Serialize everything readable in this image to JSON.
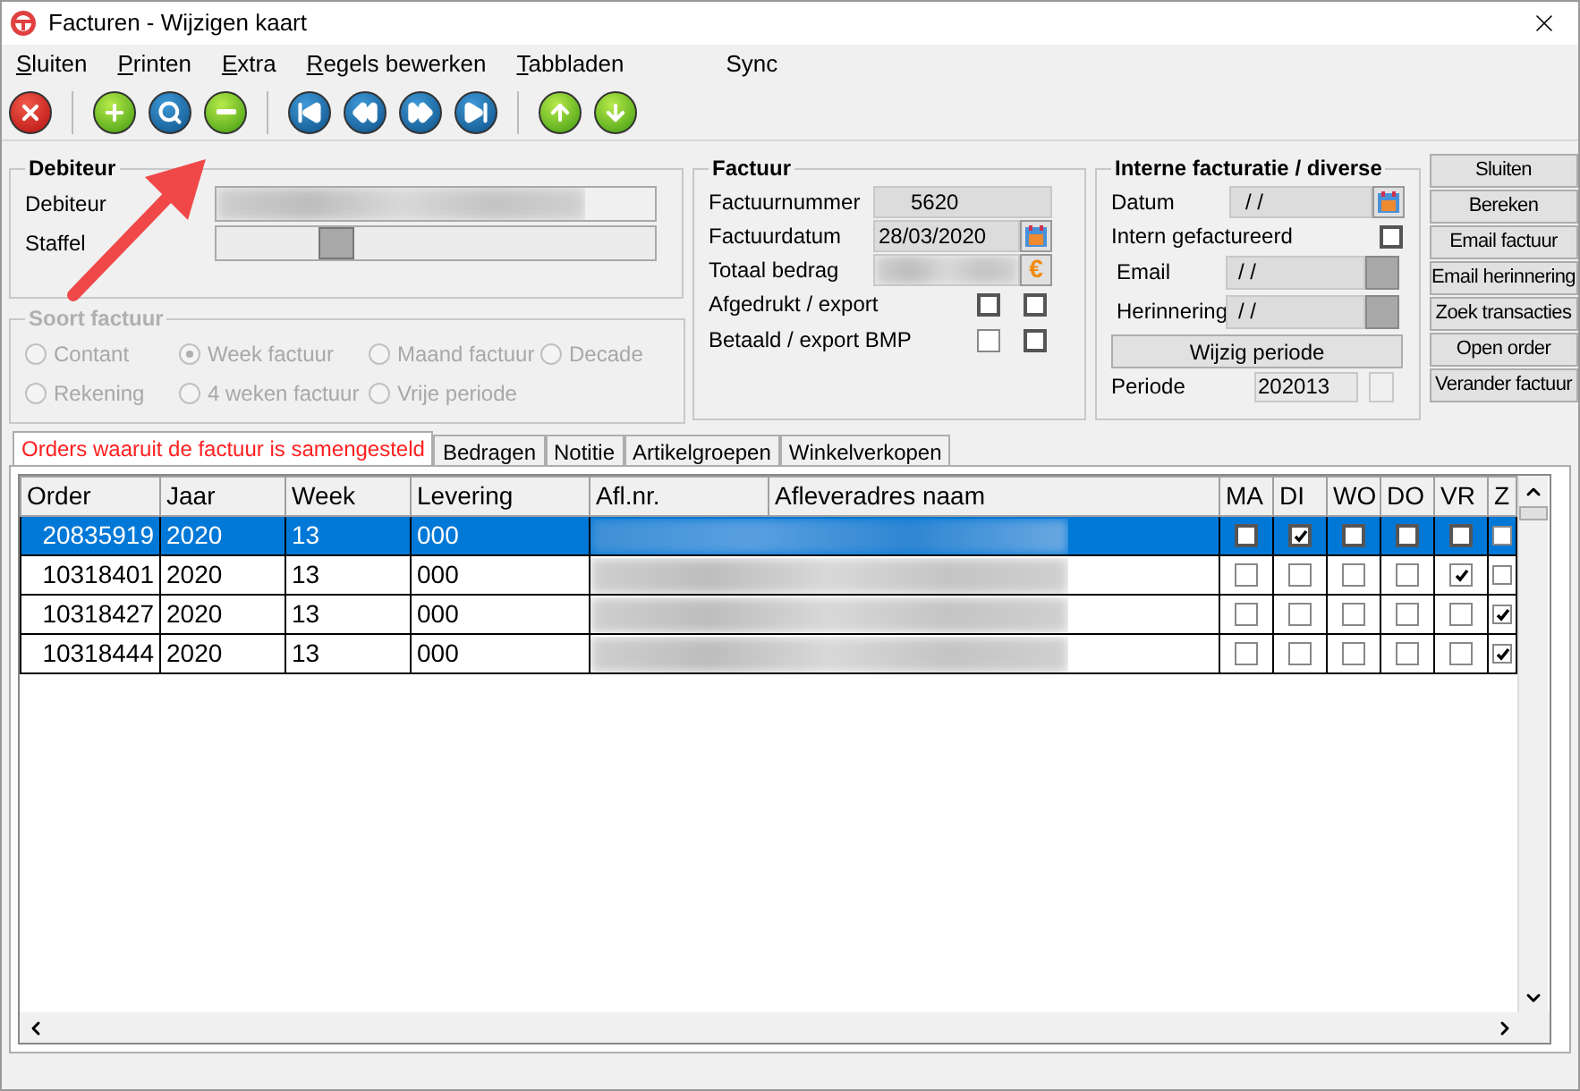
{
  "window": {
    "title": "Facturen - Wijzigen kaart"
  },
  "menu": [
    {
      "label": "Sluiten",
      "underlined": true
    },
    {
      "label": "Printen",
      "underlined": true
    },
    {
      "label": "Extra",
      "underlined": true
    },
    {
      "label": "Regels bewerken",
      "underlined": true
    },
    {
      "label": "Tabbladen",
      "underlined": true
    },
    {
      "label": "Sync",
      "underlined": false
    }
  ],
  "debiteur": {
    "title": "Debiteur",
    "debiteur_label": "Debiteur",
    "staffel_label": "Staffel",
    "staffel": {
      "level": 0.24
    }
  },
  "soort_factuur": {
    "title": "Soort factuur",
    "disabled": true,
    "options": [
      {
        "label": "Contant",
        "selected": false
      },
      {
        "label": "Week factuur",
        "selected": true
      },
      {
        "label": "Maand factuur",
        "selected": false
      },
      {
        "label": "Decade",
        "selected": false
      },
      {
        "label": "Rekening",
        "selected": false
      },
      {
        "label": "4 weken factuur",
        "selected": false
      },
      {
        "label": "Vrije periode",
        "selected": false
      }
    ]
  },
  "factuur": {
    "title": "Factuur",
    "fields": [
      {
        "label": "Factuurnummer",
        "value": "5620",
        "kind": "number"
      },
      {
        "label": "Factuurdatum",
        "value": "28/03/2020",
        "kind": "date"
      },
      {
        "label": "Totaal bedrag",
        "kind": "amount",
        "icon": "€"
      }
    ],
    "flags": [
      {
        "label": "Afgedrukt / export",
        "checks": [
          {
            "checked": false
          },
          {
            "checked": false
          }
        ]
      },
      {
        "label": "Betaald / export BMP",
        "checks": [
          {
            "checked": false
          },
          {
            "checked": false
          }
        ]
      }
    ]
  },
  "interne": {
    "title": "Interne facturatie / diverse",
    "datum": {
      "label": "Datum",
      "value": "/ /"
    },
    "intern": {
      "label": "Intern gefactureerd",
      "checked": false
    },
    "email": {
      "label": "Email",
      "value": "/ /"
    },
    "herinnering": {
      "label": "Herinnering",
      "value": "/ /"
    },
    "wijzig_button": "Wijzig periode",
    "periode": {
      "label": "Periode",
      "value": "202013"
    }
  },
  "buttons": [
    "Sluiten",
    "Bereken",
    "Email factuur",
    "Email herinnering",
    "Zoek transacties",
    "Open order",
    "Verander factuur"
  ],
  "tabs": [
    {
      "label": "Orders waaruit de factuur is samengesteld",
      "selected": true
    },
    {
      "label": "Bedragen",
      "selected": false
    },
    {
      "label": "Notitie",
      "selected": false
    },
    {
      "label": "Artikelgroepen",
      "selected": false
    },
    {
      "label": "Winkelverkopen",
      "selected": false
    }
  ],
  "table": {
    "columns": [
      "Order",
      "Jaar",
      "Week",
      "Levering",
      "Afl.nr.",
      "Afleveradres naam",
      "MA",
      "DI",
      "WO",
      "DO",
      "VR",
      "Z"
    ],
    "rows": [
      {
        "selected": true,
        "cells": [
          "20835919",
          "2020",
          "13",
          "000"
        ],
        "days": [
          false,
          true,
          false,
          false,
          false,
          false
        ]
      },
      {
        "selected": false,
        "cells": [
          "10318401",
          "2020",
          "13",
          "000"
        ],
        "days": [
          false,
          false,
          false,
          false,
          true,
          false
        ]
      },
      {
        "selected": false,
        "cells": [
          "10318427",
          "2020",
          "13",
          "000"
        ],
        "days": [
          false,
          false,
          false,
          false,
          false,
          true
        ]
      },
      {
        "selected": false,
        "cells": [
          "10318444",
          "2020",
          "13",
          "000"
        ],
        "days": [
          false,
          false,
          false,
          false,
          false,
          true
        ]
      }
    ]
  }
}
